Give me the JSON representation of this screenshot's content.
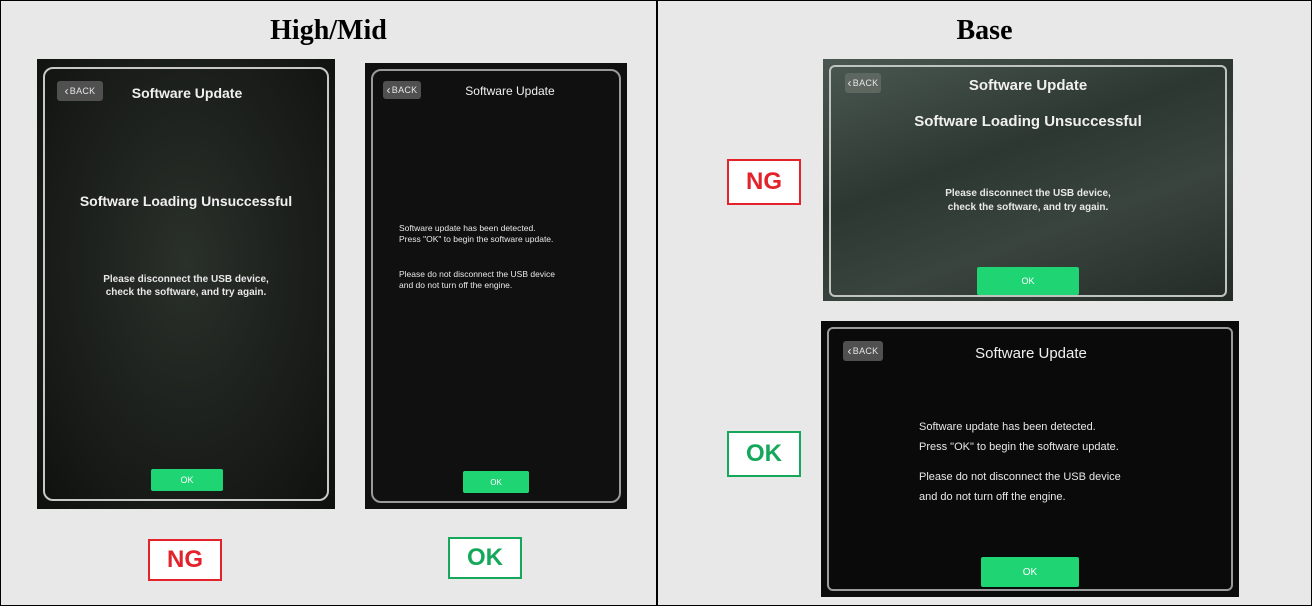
{
  "columns": {
    "left_title": "High/Mid",
    "right_title": "Base"
  },
  "screens": {
    "high_ng": {
      "back": "BACK",
      "title": "Software Update",
      "heading": "Software Loading Unsuccessful",
      "message": "Please disconnect the USB device,\ncheck the software, and try again.",
      "ok": "OK"
    },
    "high_ok": {
      "back": "BACK",
      "title": "Software Update",
      "message1": "Software update has been detected.\nPress \"OK\" to begin the software update.",
      "message2": "Please do not disconnect the USB device\nand do not turn off the engine.",
      "ok": "OK"
    },
    "base_ng": {
      "back": "BACK",
      "title": "Software Update",
      "heading": "Software Loading Unsuccessful",
      "message": "Please disconnect the USB device,\ncheck the software, and try again.",
      "ok": "OK"
    },
    "base_ok": {
      "back": "BACK",
      "title": "Software Update",
      "message1": "Software update has been detected.\nPress \"OK\" to begin the software update.",
      "message2": "Please do not disconnect the USB device\nand do not turn off the engine.",
      "ok": "OK"
    }
  },
  "labels": {
    "ng": "NG",
    "ok": "OK"
  },
  "colors": {
    "ng": "#e2232b",
    "ok": "#15a85a",
    "screen_button": "#1fd573"
  }
}
